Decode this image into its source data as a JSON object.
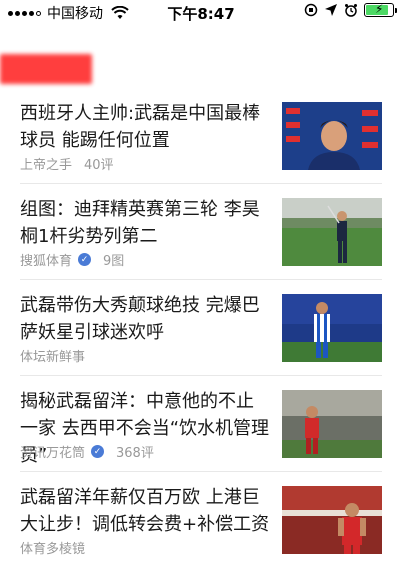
{
  "status_bar": {
    "carrier": "中国移动",
    "time": "下午8:47",
    "battery_level": 0.85
  },
  "news": [
    {
      "title": "西班牙人主帅:武磊是中国最棒球员 能踢任何位置",
      "source": "上帝之手",
      "verified": false,
      "count": "40评",
      "image": "press-conference-photo"
    },
    {
      "title": "组图：迪拜精英赛第三轮 李昊桐1杆劣势列第二",
      "source": "搜狐体育",
      "verified": true,
      "count": "9图",
      "image": "golfer-photo"
    },
    {
      "title": "武磊带伤大秀颠球绝技 完爆巴萨妖星引球迷欢呼",
      "source": "体坛新鲜事",
      "verified": false,
      "count": "",
      "image": "player-stadium-photo"
    },
    {
      "title": "揭秘武磊留洋：中意他的不止一家 去西甲不会当“饮水机管理员”",
      "source": "资讯万花筒",
      "verified": true,
      "count": "368评",
      "image": "player-red-jersey-photo"
    },
    {
      "title": "武磊留洋年薪仅百万欧 上港巨大让步！调低转会费+补偿工资",
      "source": "体育多棱镜",
      "verified": false,
      "count": "",
      "image": "player-celebration-photo"
    }
  ],
  "colors": {
    "header_red": "#ff2a2a",
    "meta_gray": "#999999",
    "verified_blue": "#4a7bd6",
    "battery_green": "#4cd964"
  }
}
